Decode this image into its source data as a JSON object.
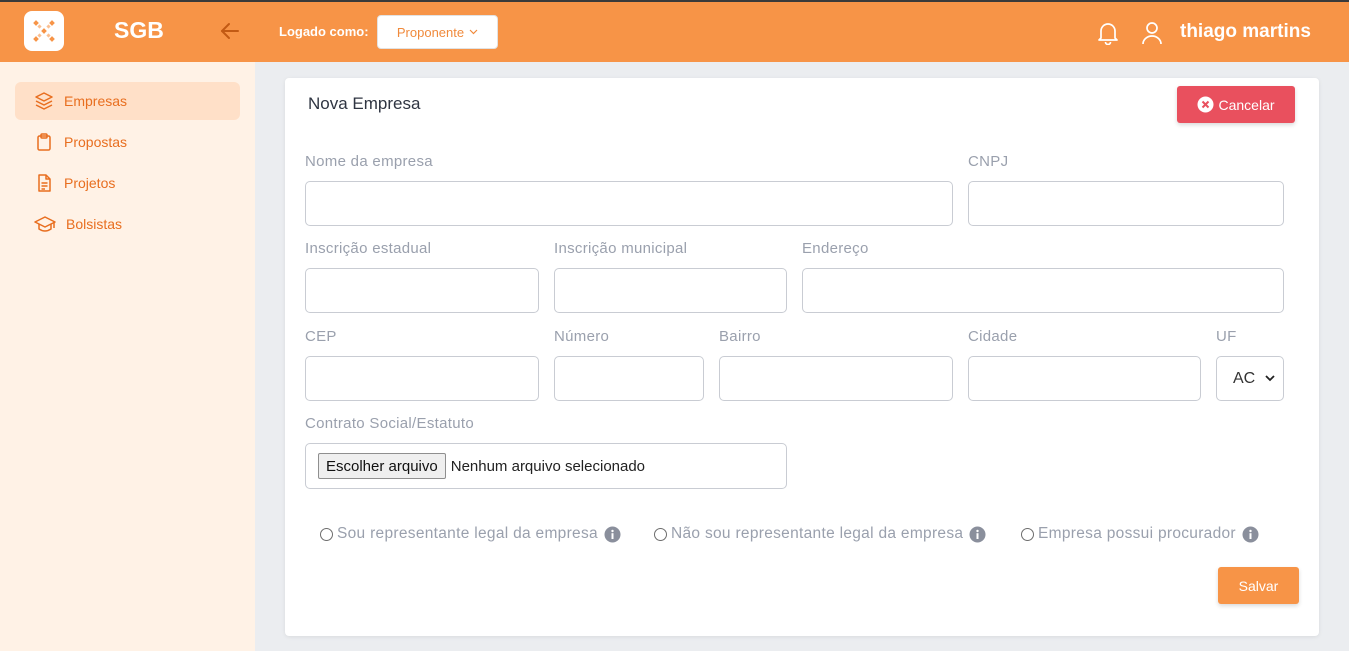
{
  "app": {
    "brand": "SGB"
  },
  "topbar": {
    "logged_label": "Logado como:",
    "role": "Proponente",
    "username": "thiago martins"
  },
  "sidebar": {
    "items": [
      {
        "label": "Empresas",
        "icon": "layers-icon",
        "active": true
      },
      {
        "label": "Propostas",
        "icon": "clipboard-icon",
        "active": false
      },
      {
        "label": "Projetos",
        "icon": "document-icon",
        "active": false
      },
      {
        "label": "Bolsistas",
        "icon": "graduation-cap-icon",
        "active": false
      }
    ]
  },
  "form": {
    "title": "Nova Empresa",
    "cancel_label": "Cancelar",
    "save_label": "Salvar",
    "fields": {
      "nome": {
        "label": "Nome da empresa",
        "value": ""
      },
      "cnpj": {
        "label": "CNPJ",
        "value": ""
      },
      "inscricao_estadual": {
        "label": "Inscrição estadual",
        "value": ""
      },
      "inscricao_municipal": {
        "label": "Inscrição municipal",
        "value": ""
      },
      "endereco": {
        "label": "Endereço",
        "value": ""
      },
      "cep": {
        "label": "CEP",
        "value": ""
      },
      "numero": {
        "label": "Número",
        "value": ""
      },
      "bairro": {
        "label": "Bairro",
        "value": ""
      },
      "cidade": {
        "label": "Cidade",
        "value": ""
      },
      "uf": {
        "label": "UF",
        "value": "AC"
      },
      "contrato": {
        "label": "Contrato Social/Estatuto",
        "button": "Escolher arquivo",
        "status": "Nenhum arquivo selecionado"
      }
    },
    "radios": [
      {
        "label": "Sou representante legal da empresa"
      },
      {
        "label": "Não sou representante legal da empresa"
      },
      {
        "label": "Empresa possui procurador"
      }
    ]
  },
  "colors": {
    "accent": "#f79447",
    "sidebar_bg": "#fff2e6",
    "active_item_bg": "#ffe0c8",
    "nav_text": "#e86e1f",
    "danger": "#e9505e"
  }
}
